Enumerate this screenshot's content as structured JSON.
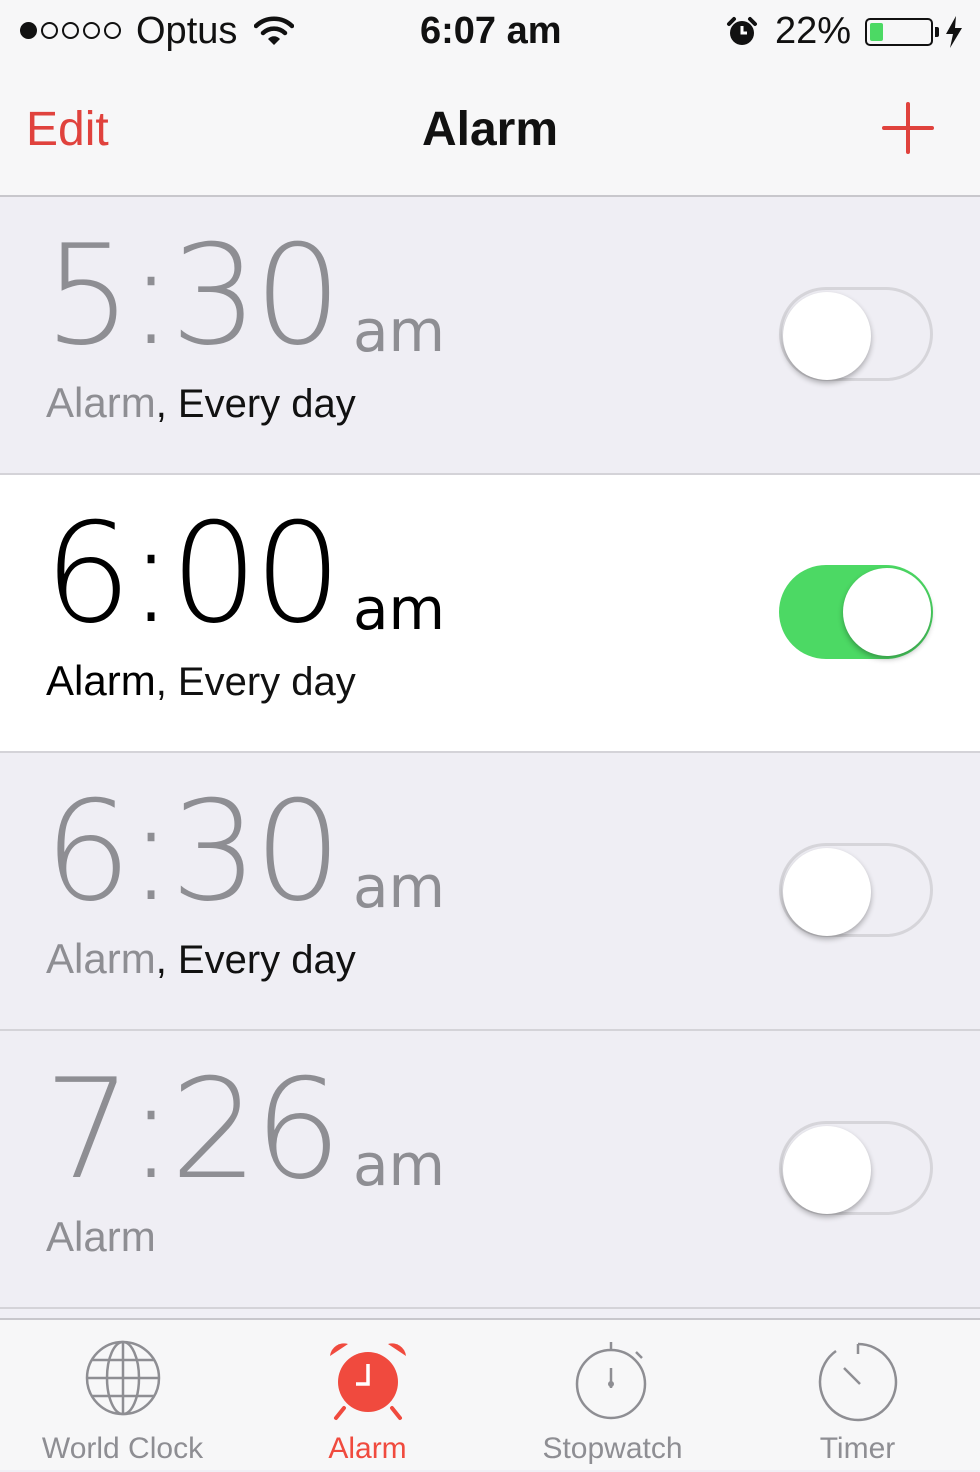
{
  "status_bar": {
    "carrier": "Optus",
    "signal_bars": [
      true,
      false,
      false,
      false,
      false
    ],
    "time": "6:07 am",
    "battery_percent": "22%",
    "battery_level": 0.22
  },
  "navbar": {
    "edit_label": "Edit",
    "title": "Alarm",
    "add_icon": "plus-icon"
  },
  "alarms": [
    {
      "time": "5:30",
      "ampm": "am",
      "label": "Alarm",
      "repeat": ", Every day",
      "enabled": false
    },
    {
      "time": "6:00",
      "ampm": "am",
      "label": "Alarm",
      "repeat": ", Every day",
      "enabled": true
    },
    {
      "time": "6:30",
      "ampm": "am",
      "label": "Alarm",
      "repeat": ", Every day",
      "enabled": false
    },
    {
      "time": "7:26",
      "ampm": "am",
      "label": "Alarm",
      "repeat": "",
      "enabled": false
    }
  ],
  "tabs": [
    {
      "label": "World Clock",
      "icon": "globe-icon",
      "active": false
    },
    {
      "label": "Alarm",
      "icon": "alarm-clock-icon",
      "active": true
    },
    {
      "label": "Stopwatch",
      "icon": "stopwatch-icon",
      "active": false
    },
    {
      "label": "Timer",
      "icon": "timer-icon",
      "active": false
    }
  ],
  "colors": {
    "accent_red": "#e0423d",
    "toggle_on": "#4cd964",
    "inactive_gray": "#8e8e93"
  }
}
